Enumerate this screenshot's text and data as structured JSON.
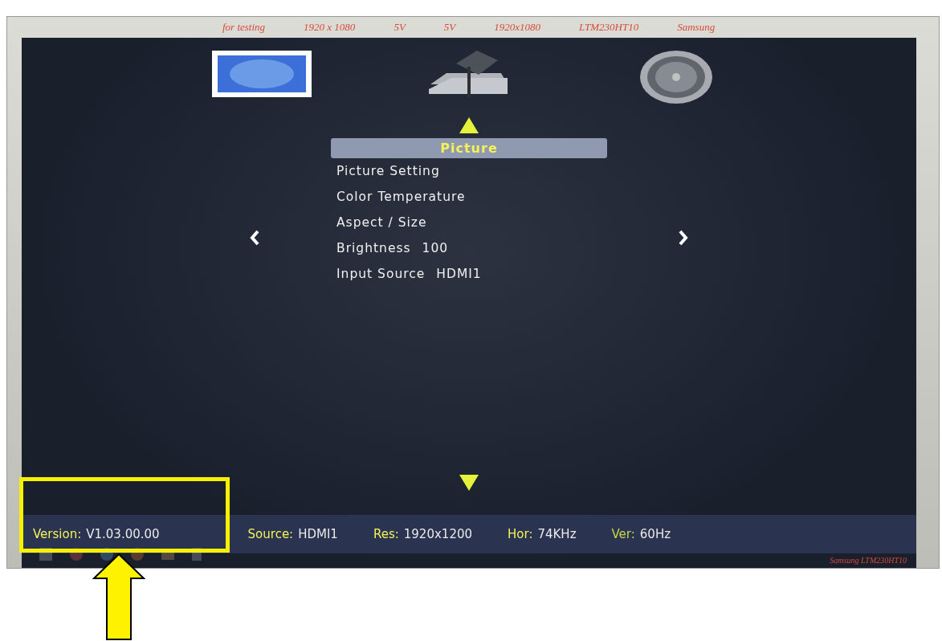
{
  "bezel_labels": [
    {
      "text": "for testing"
    },
    {
      "text": "1920 x 1080"
    },
    {
      "text": "5V"
    },
    {
      "text": "5V"
    },
    {
      "text": "1920x1080"
    },
    {
      "text": "LTM230HT10"
    },
    {
      "text": "Samsung"
    }
  ],
  "top_icons": [
    {
      "kind": "monitor",
      "selected": true
    },
    {
      "kind": "tools",
      "selected": false
    },
    {
      "kind": "speaker",
      "selected": false
    }
  ],
  "menu": {
    "title": "Picture",
    "items": [
      {
        "label": "Picture Setting"
      },
      {
        "label": "Color Temperature"
      },
      {
        "label": "Aspect / Size"
      },
      {
        "label": "Brightness",
        "value": "100"
      },
      {
        "label": "Input Source",
        "value": "HDMI1"
      }
    ]
  },
  "status_bar": [
    {
      "label": "Version:",
      "value": "V1.03.00.00",
      "color": "#f4f25a"
    },
    {
      "label": "Source:",
      "value": "HDMI1",
      "color": "#f4f25a"
    },
    {
      "label": "Res:",
      "value": "1920x1200",
      "color": "#f4f25a"
    },
    {
      "label": "Hor:",
      "value": "74KHz",
      "color": "#f4f25a"
    },
    {
      "label": "Ver:",
      "value": "60Hz",
      "color": "#c8d64a"
    }
  ],
  "bezel_bottom_label": "Samsung LTM230HT10"
}
